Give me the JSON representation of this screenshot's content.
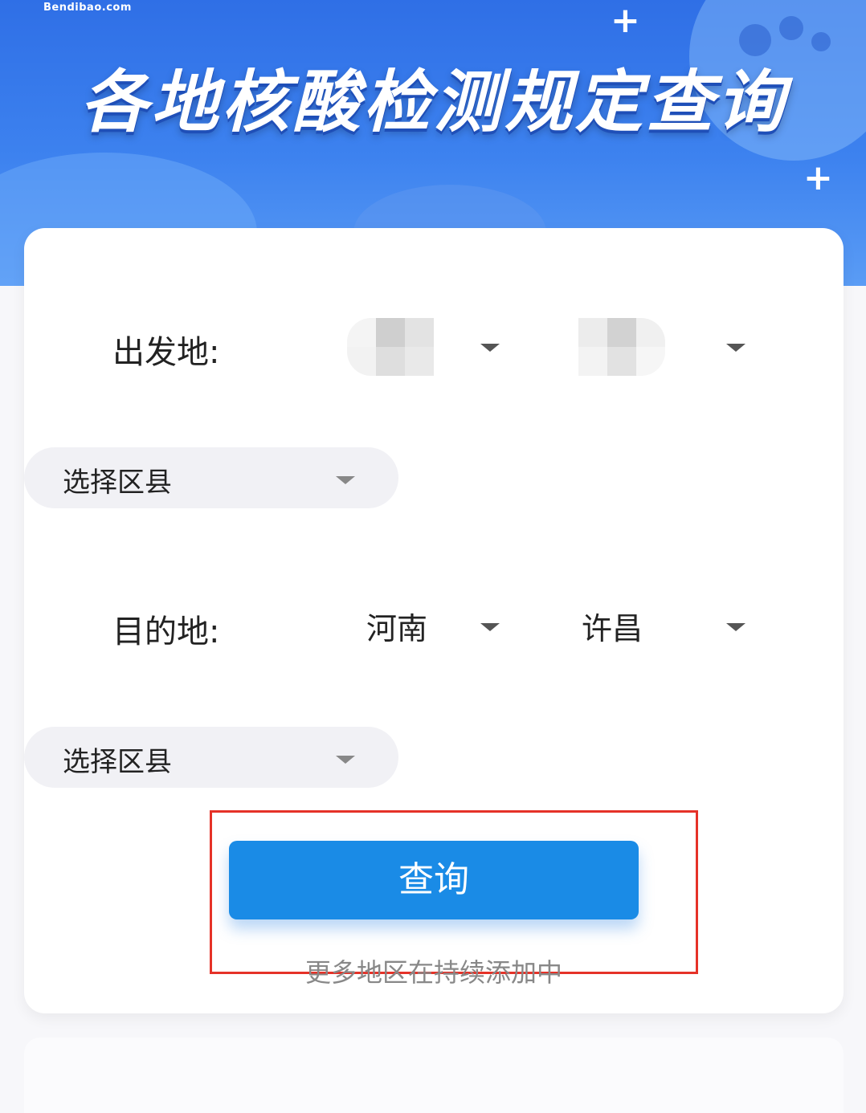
{
  "header": {
    "brand": "Bendibao.com",
    "title": "各地核酸检测规定查询"
  },
  "origin": {
    "label": "出发地:",
    "province_value": "",
    "city_value": "",
    "district_placeholder": "选择区县"
  },
  "destination": {
    "label": "目的地:",
    "province_value": "河南",
    "city_value": "许昌",
    "district_placeholder": "选择区县"
  },
  "actions": {
    "query_label": "查询"
  },
  "footer": {
    "hint": "更多地区在持续添加中"
  },
  "colors": {
    "banner": "#3d82ef",
    "button": "#1a8be6",
    "highlight_box": "#e53228"
  }
}
